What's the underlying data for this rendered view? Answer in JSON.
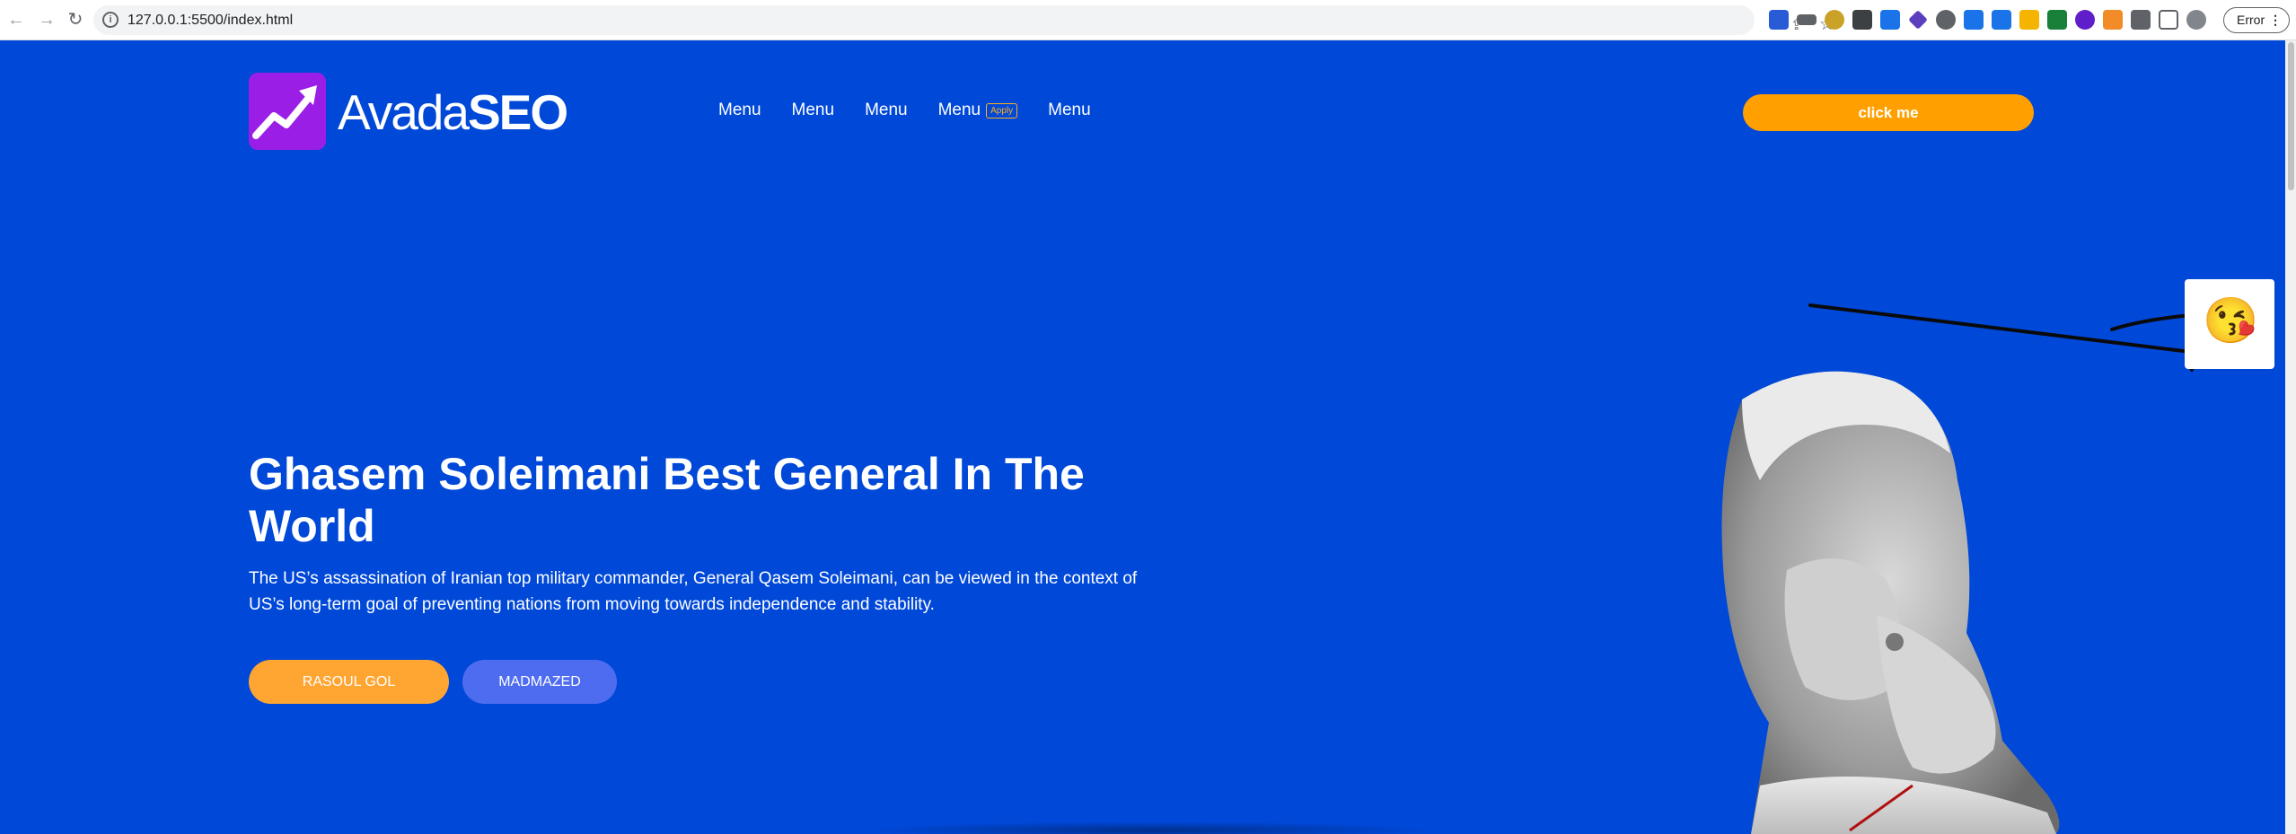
{
  "browser": {
    "url": "127.0.0.1:5500/index.html",
    "error_label": "Error",
    "extension_icons": [
      "extension-1-icon",
      "extension-2-icon",
      "extension-3-icon",
      "extension-4-icon",
      "extension-5-icon",
      "extension-6-icon",
      "extension-7-icon",
      "extension-8-icon",
      "extension-9-icon",
      "extension-10-icon",
      "extension-11-icon",
      "extension-12-icon",
      "extension-13-icon",
      "extensions-puzzle-icon",
      "side-panel-icon",
      "profile-avatar"
    ]
  },
  "header": {
    "logo_light": "Avada",
    "logo_bold": "SEO",
    "menu": [
      {
        "label": "Menu",
        "badge": ""
      },
      {
        "label": "Menu",
        "badge": ""
      },
      {
        "label": "Menu",
        "badge": ""
      },
      {
        "label": "Menu",
        "badge": "Apply"
      },
      {
        "label": "Menu",
        "badge": ""
      }
    ],
    "cta_label": "click me"
  },
  "hero": {
    "title": "Ghasem Soleimani Best General In The World",
    "subtitle": "The US’s assassination of Iranian top military commander, General Qasem Soleimani, can be viewed in the context of US’s long-term goal of preventing nations from moving towards independence and stability.",
    "primary_button": "RASOUL GOL",
    "secondary_button": "MADMAZED"
  },
  "floating": {
    "emoji": "😘"
  },
  "colors": {
    "page_bg": "#0048d8",
    "accent_orange": "#ffa000",
    "logo_purple": "#9b1ee6",
    "secondary_button": "#4e6cf0"
  }
}
